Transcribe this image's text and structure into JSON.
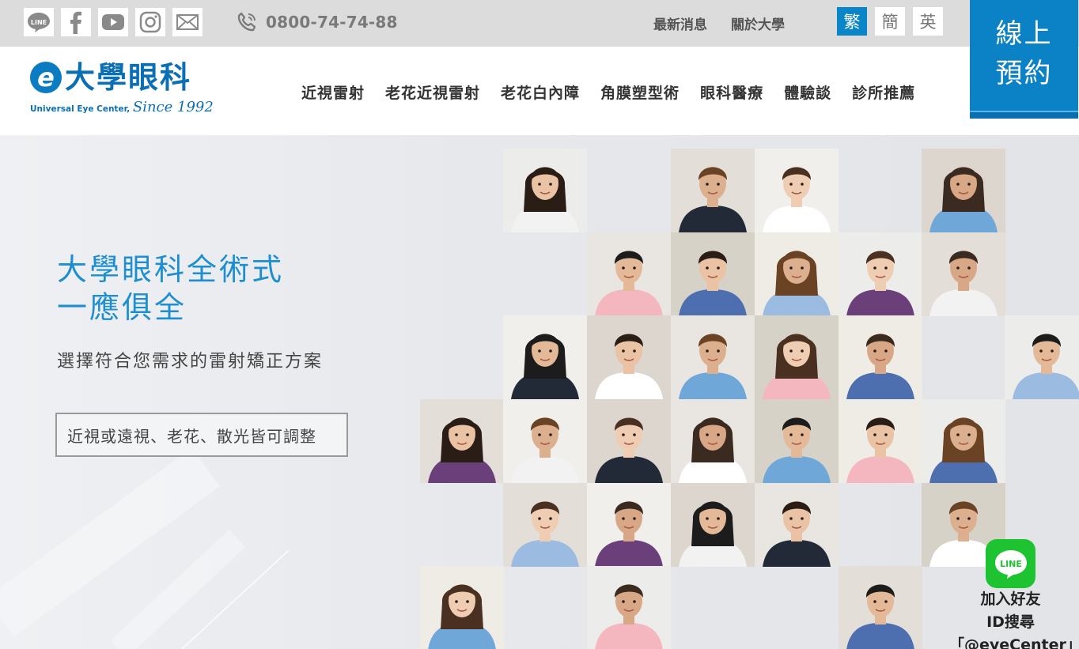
{
  "topbar": {
    "social": [
      {
        "name": "line-icon",
        "label": "LINE"
      },
      {
        "name": "facebook-icon",
        "label": "f"
      },
      {
        "name": "youtube-icon",
        "label": ""
      },
      {
        "name": "instagram-icon",
        "label": ""
      },
      {
        "name": "mail-icon",
        "label": ""
      }
    ],
    "phone": "0800-74-74-88",
    "links": [
      "最新消息",
      "關於大學"
    ],
    "languages": [
      {
        "label": "繁",
        "active": true
      },
      {
        "label": "簡",
        "active": false
      },
      {
        "label": "英",
        "active": false
      }
    ]
  },
  "booking": {
    "line1": "線上",
    "line2": "預約"
  },
  "logo": {
    "mark": "e",
    "name": "大學眼科",
    "sub": "Universal Eye Center,",
    "since": "Since 1992"
  },
  "nav": [
    "近視雷射",
    "老花近視雷射",
    "老花白內障",
    "角膜塑型術",
    "眼科醫療",
    "體驗談",
    "診所推薦"
  ],
  "hero": {
    "headline1": "大學眼科全術式",
    "headline2": "一應俱全",
    "subline": "選擇符合您需求的雷射矯正方案",
    "tag": "近視或遠視、老花、散光皆可調整"
  },
  "line_widget": {
    "logo_text": "LINE",
    "line1": "加入好友",
    "line2": "ID搜尋",
    "line3": "「@eyeCenter」"
  },
  "colors": {
    "brand_blue": "#0b82c6",
    "line_green": "#1dc331",
    "headline_blue": "#1d8fd0"
  }
}
